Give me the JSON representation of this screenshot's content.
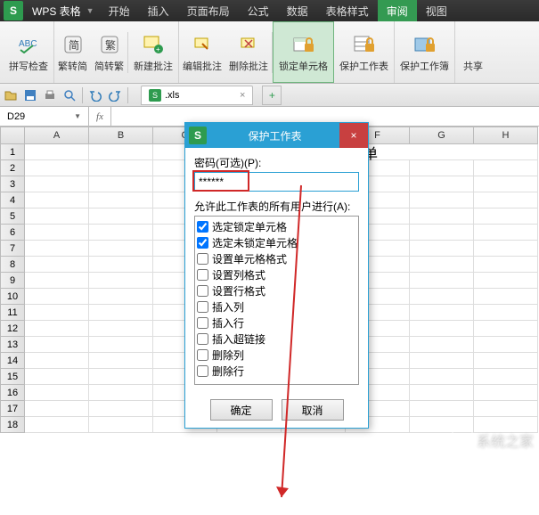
{
  "app": {
    "logo": "S",
    "name": "WPS 表格",
    "dropdown": "▼"
  },
  "menu": [
    "开始",
    "插入",
    "页面布局",
    "公式",
    "数据",
    "表格样式",
    "审阅",
    "视图"
  ],
  "menu_active_index": 6,
  "ribbon": {
    "spellcheck": "拼写检查",
    "to_simplified": "繁转简",
    "to_traditional": "简转繁",
    "new_comment": "新建批注",
    "edit_comment": "编辑批注",
    "delete_comment": "删除批注",
    "lock_cell": "锁定单元格",
    "protect_sheet": "保护工作表",
    "protect_book": "保护工作簿",
    "share": "共享"
  },
  "doc": {
    "name": ".xls",
    "close": "×",
    "add": "+"
  },
  "namebox": "D29",
  "fx": "fx",
  "columns": [
    "A",
    "B",
    "C",
    "D",
    "E",
    "F",
    "G",
    "H"
  ],
  "row_count": 18,
  "sheet_text": "管理人员名单",
  "dialog": {
    "title": "保护工作表",
    "pw_label": "密码(可选)(P):",
    "pw_value": "******",
    "allow_label": "允许此工作表的所有用户进行(A):",
    "perms": [
      {
        "label": "选定锁定单元格",
        "checked": true
      },
      {
        "label": "选定未锁定单元格",
        "checked": true
      },
      {
        "label": "设置单元格格式",
        "checked": false
      },
      {
        "label": "设置列格式",
        "checked": false
      },
      {
        "label": "设置行格式",
        "checked": false
      },
      {
        "label": "插入列",
        "checked": false
      },
      {
        "label": "插入行",
        "checked": false
      },
      {
        "label": "插入超链接",
        "checked": false
      },
      {
        "label": "删除列",
        "checked": false
      },
      {
        "label": "删除行",
        "checked": false
      }
    ],
    "ok": "确定",
    "cancel": "取消",
    "close": "×"
  },
  "watermark": "系统之家",
  "colors": {
    "accent": "#2e9b4f",
    "dialog": "#2aa0d4",
    "highlight": "#d02828"
  }
}
